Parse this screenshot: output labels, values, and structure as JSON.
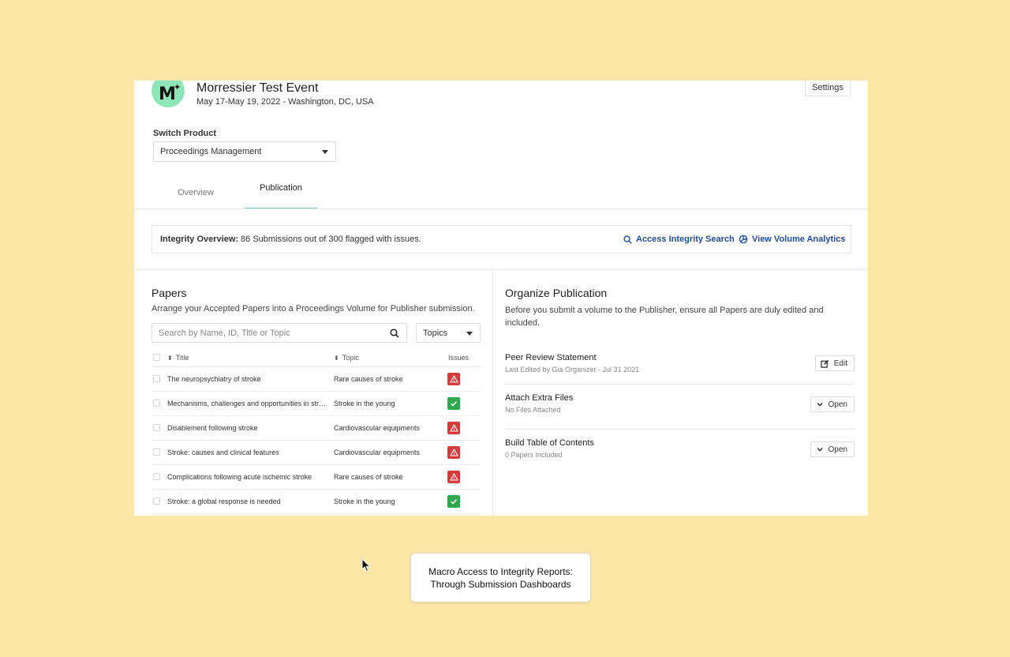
{
  "event": {
    "logo_letter": "M",
    "title": "Morressier Test Event",
    "subtitle": "May 17-May 19, 2022 - Washington, DC, USA",
    "settings_label": "Settings"
  },
  "switch_product": {
    "label": "Switch Product",
    "selected": "Proceedings Management"
  },
  "tabs": [
    {
      "label": "Overview",
      "active": false
    },
    {
      "label": "Publication",
      "active": true
    }
  ],
  "integrity": {
    "label": "Integrity Overview:",
    "text": "86 Submissions out of 300 flagged with issues.",
    "search_link": "Access Integrity Search",
    "analytics_link": "View Volume Analytics"
  },
  "papers": {
    "title": "Papers",
    "description": "Arrange your Accepted Papers into a Proceedings Volume for Publisher submission.",
    "search_placeholder": "Search by Name, ID, Title or Topic",
    "topics_label": "Topics",
    "columns": {
      "title": "Title",
      "topic": "Topic",
      "issues": "Issues"
    },
    "rows": [
      {
        "title": "The neuropsychiatry of stroke",
        "topic": "Rare causes of stroke",
        "issue": "warning"
      },
      {
        "title": "Mechanisms, challenges and opportunities in stro...",
        "topic": "Stroke in the young",
        "issue": "ok"
      },
      {
        "title": "Disablement following stroke",
        "topic": "Cardiovascular equipments",
        "issue": "warning"
      },
      {
        "title": "Stroke: causes and clinical features",
        "topic": "Cardiovascular equipments",
        "issue": "warning"
      },
      {
        "title": "Complications following acute ischemic stroke",
        "topic": "Rare causes of stroke",
        "issue": "warning"
      },
      {
        "title": "Stroke: a global response is needed",
        "topic": "Stroke in the young",
        "issue": "ok"
      }
    ]
  },
  "organize": {
    "title": "Organize Publication",
    "description": "Before you submit a volume to the Publisher, ensure all Papers are duly edited and included.",
    "items": [
      {
        "name": "Peer Review Statement",
        "meta": "Last Edited by Gia Organizer - Jul 31 2021",
        "button": "Edit",
        "icon": "edit-icon"
      },
      {
        "name": "Attach Extra Files",
        "meta": "No Files Attached",
        "button": "Open",
        "icon": "chevron-down-icon"
      },
      {
        "name": "Build Table of Contents",
        "meta": "0 Papers Included",
        "button": "Open",
        "icon": "chevron-down-icon"
      }
    ]
  },
  "caption": {
    "line1": "Macro Access to Integrity Reports:",
    "line2": "Through Submission Dashboards"
  },
  "colors": {
    "background": "#fde6a8",
    "logo": "#8ee5b8",
    "link": "#1f4d97",
    "warning": "#d63a3a",
    "ok": "#2fa84f",
    "tab_underline": "#7fc6cf"
  }
}
